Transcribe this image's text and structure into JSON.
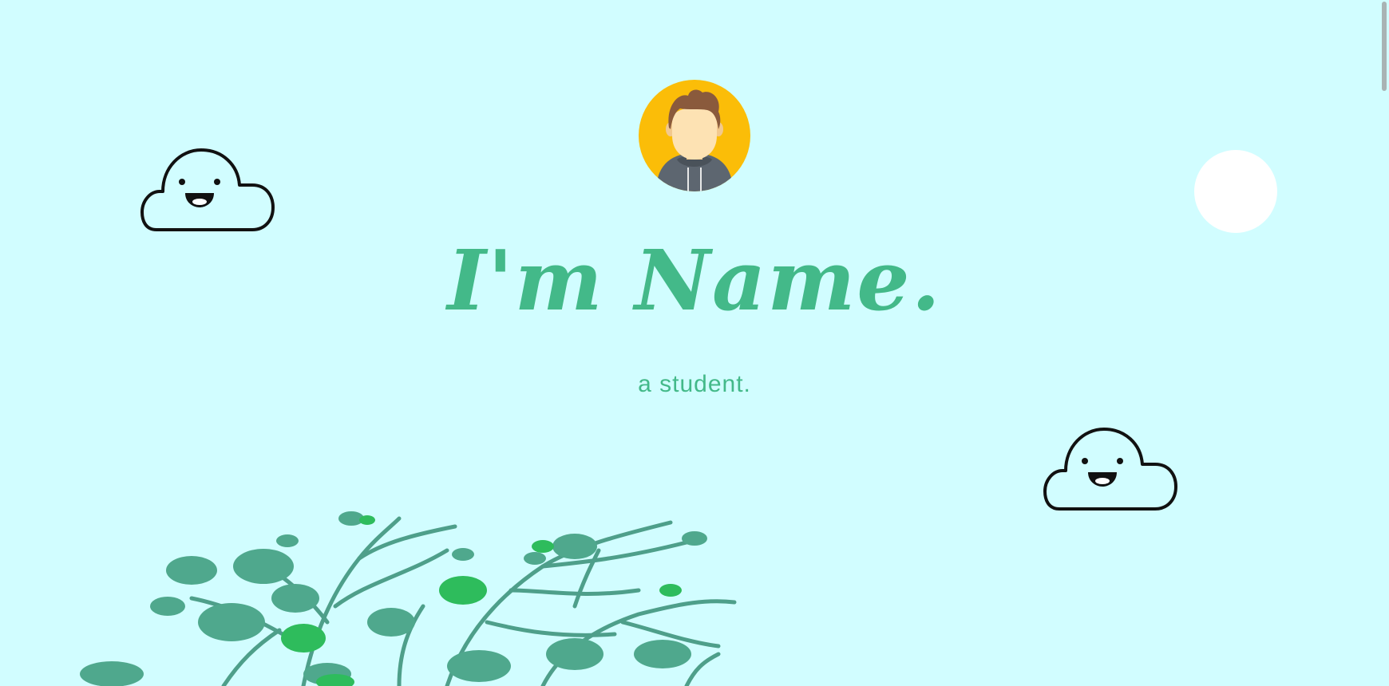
{
  "hero": {
    "title": "I'm Name.",
    "subtitle": "a student."
  },
  "icons": {
    "avatar": "avatar-icon",
    "cloud_left": "smiling-cloud-icon",
    "cloud_right": "smiling-cloud-icon",
    "moon": "moon-icon",
    "trees": "tree-branches-illustration"
  },
  "colors": {
    "background": "#d1fdff",
    "accent": "#43b989",
    "avatar_bg": "#fbbd08",
    "foliage_dark": "#4fa88d",
    "foliage_light": "#2ebc5c"
  }
}
